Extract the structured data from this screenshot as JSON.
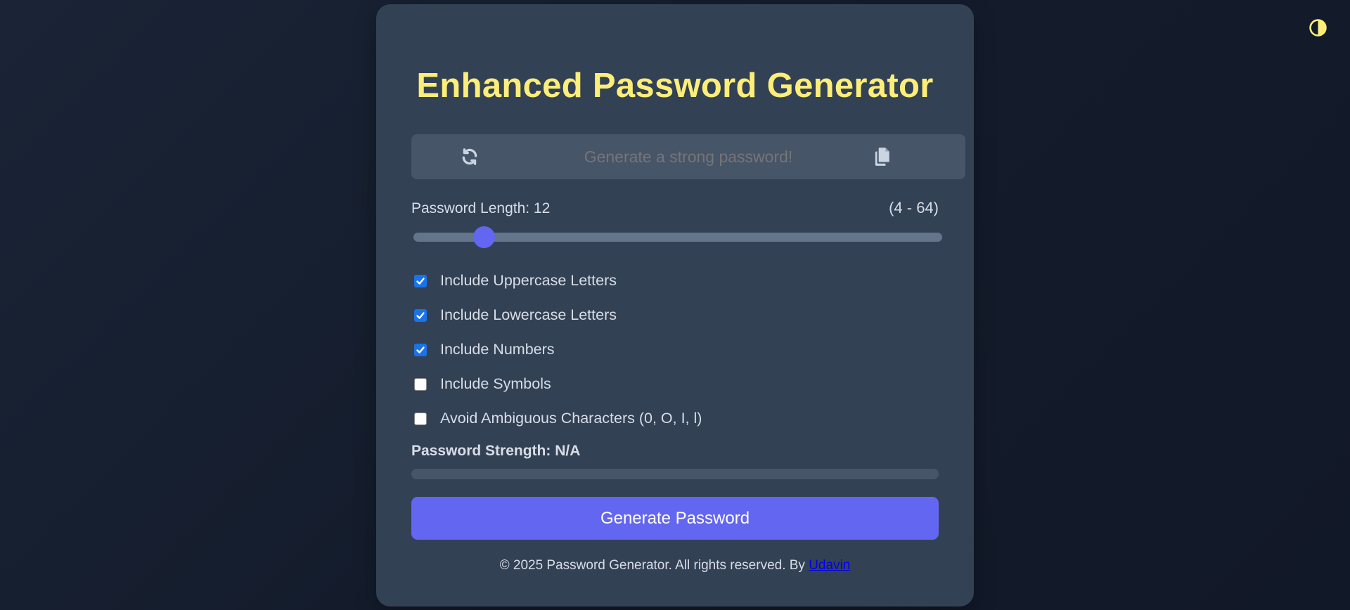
{
  "theme_toggle": {
    "icon": "contrast-icon",
    "color": "#fcee78"
  },
  "title": "Enhanced Password Generator",
  "password": {
    "placeholder": "Generate a strong password!",
    "value": "",
    "refresh_icon": "refresh-icon",
    "copy_icon": "copy-icon"
  },
  "length": {
    "label": "Password Length: 12",
    "value": 12,
    "min": 4,
    "max": 64,
    "range_text": "(4 - 64)"
  },
  "options": [
    {
      "label": "Include Uppercase Letters",
      "checked": true
    },
    {
      "label": "Include Lowercase Letters",
      "checked": true
    },
    {
      "label": "Include Numbers",
      "checked": true
    },
    {
      "label": "Include Symbols",
      "checked": false
    },
    {
      "label": "Avoid Ambiguous Characters (0, O, I, l)",
      "checked": false
    }
  ],
  "strength": {
    "label": "Password Strength: N/A",
    "level": 0
  },
  "generate_button": "Generate Password",
  "footer": {
    "text": "© 2025 Password Generator. All rights reserved. By ",
    "link": "Udavin"
  },
  "colors": {
    "background": "#151e2e",
    "card": "#334155",
    "title": "#fcee78",
    "accent": "#6366f1",
    "checkbox": "#1a73e8"
  }
}
